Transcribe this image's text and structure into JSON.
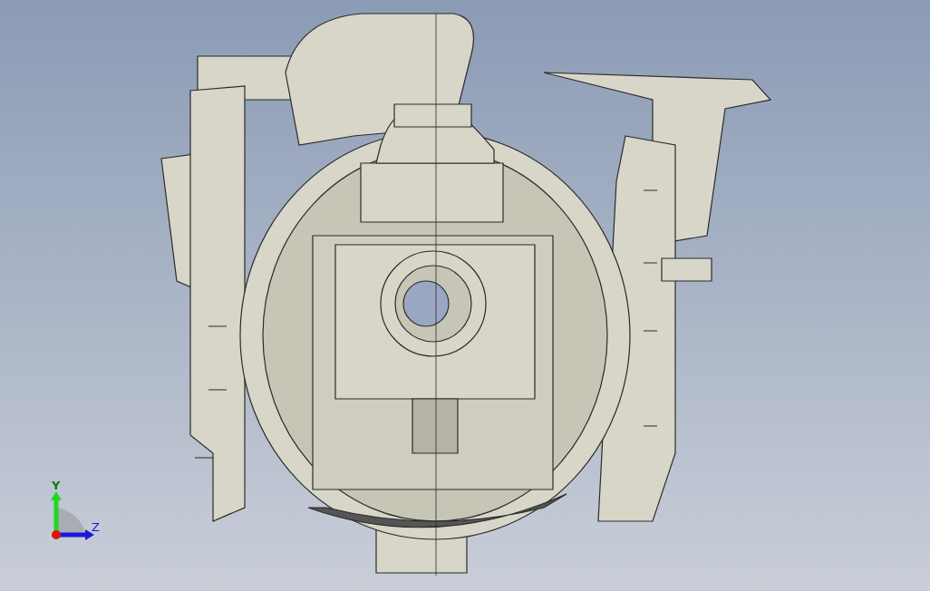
{
  "viewport": {
    "axes": [
      {
        "label": "Y",
        "kind": "y"
      },
      {
        "label": "Z",
        "kind": "z"
      }
    ]
  }
}
